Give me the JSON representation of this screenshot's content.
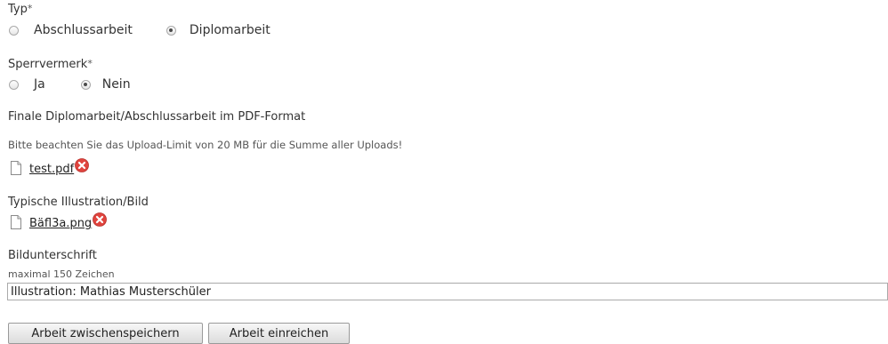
{
  "typ": {
    "label": "Typ",
    "required_mark": "*",
    "options": [
      "Abschlussarbeit",
      "Diplomarbeit"
    ],
    "selected": "Diplomarbeit"
  },
  "sperrvermerk": {
    "label": "Sperrvermerk",
    "required_mark": "*",
    "options": [
      "Ja",
      "Nein"
    ],
    "selected": "Nein"
  },
  "pdf": {
    "heading": "Finale Diplomarbeit/Abschlussarbeit im PDF-Format",
    "hint": "Bitte beachten Sie das Upload-Limit von 20 MB für die Summe aller Uploads!",
    "file_name": "test.pdf",
    "file_icon": "document-icon",
    "delete_icon": "delete-icon"
  },
  "illustration": {
    "heading": "Typische Illustration/Bild",
    "file_name": "Bäfl3a.png",
    "file_icon": "document-icon",
    "delete_icon": "delete-icon"
  },
  "caption": {
    "heading": "Bildunterschrift",
    "hint": "maximal 150 Zeichen",
    "value": "Illustration: Mathias Musterschüler"
  },
  "buttons": {
    "save_label": "Arbeit zwischenspeichern",
    "submit_label": "Arbeit einreichen"
  },
  "colors": {
    "delete": "#e0443e",
    "text": "#333333"
  }
}
